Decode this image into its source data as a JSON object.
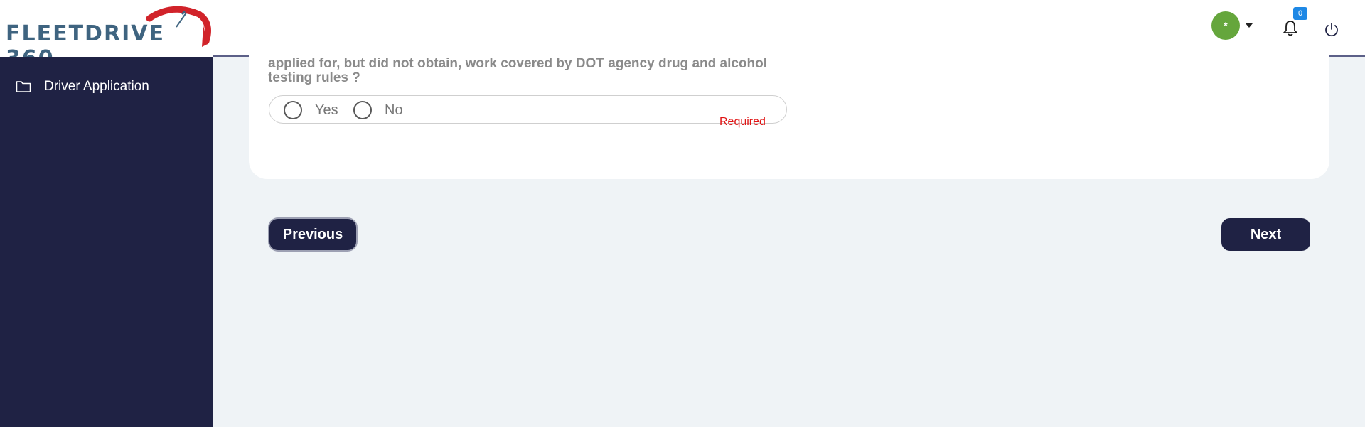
{
  "brand": {
    "name": "FLEETDRIVE 360"
  },
  "header": {
    "avatar_initial": "*",
    "notifications_count": "0"
  },
  "sidebar": {
    "items": [
      {
        "label": "Driver Application",
        "icon": "folder-icon"
      }
    ]
  },
  "form": {
    "question_line_1": "applied for, but did not obtain, work covered by DOT agency drug and alcohol",
    "question_line_2": "testing rules ?",
    "options": [
      {
        "label": "Yes"
      },
      {
        "label": "No"
      }
    ],
    "validation_message": "Required"
  },
  "navigation": {
    "previous_label": "Previous",
    "next_label": "Next"
  },
  "colors": {
    "sidebar_bg": "#1f2244",
    "button_bg": "#1f2244",
    "page_bg": "#eff3f6",
    "avatar_bg": "#65a63c",
    "badge_bg": "#1e88e5",
    "required_text": "#e01414",
    "logo_text": "#3f6480",
    "logo_accent": "#d1232a"
  }
}
